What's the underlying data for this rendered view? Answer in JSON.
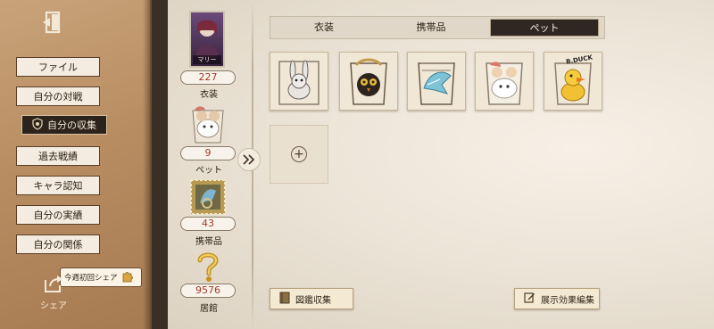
{
  "sidebar": {
    "items": [
      {
        "label": "ファイル",
        "active": false
      },
      {
        "label": "自分の対戦",
        "active": false
      },
      {
        "label": "自分の収集",
        "active": true
      },
      {
        "label": "過去戦績",
        "active": false
      },
      {
        "label": "キャラ認知",
        "active": false
      },
      {
        "label": "自分の実績",
        "active": false
      },
      {
        "label": "自分の関係",
        "active": false
      }
    ],
    "share_badge": "今週初回シェア",
    "share_label": "シェア"
  },
  "stats": {
    "costume": {
      "count": "227",
      "label": "衣装",
      "card_label": "マリー"
    },
    "pet": {
      "count": "9",
      "label": "ペット"
    },
    "accessory": {
      "count": "43",
      "label": "携帯品"
    },
    "residence": {
      "count": "9576",
      "label": "居館"
    }
  },
  "tabs": [
    {
      "label": "衣装",
      "active": false
    },
    {
      "label": "携帯品",
      "active": false
    },
    {
      "label": "ペット",
      "active": true
    }
  ],
  "pets": [
    {
      "name": "rabbit-pet-icon"
    },
    {
      "name": "owl-pet-icon"
    },
    {
      "name": "bird-pet-icon"
    },
    {
      "name": "goat-pet-icon"
    },
    {
      "name": "duck-pet-icon",
      "caption": "B.DUCK"
    }
  ],
  "bottom": {
    "catalog_label": "図鑑収集",
    "display_label": "展示効果編集"
  },
  "colors": {
    "accent_red": "#a23a2b",
    "sidebar_brown": "#b98d62",
    "dark_active": "#2b231c"
  }
}
